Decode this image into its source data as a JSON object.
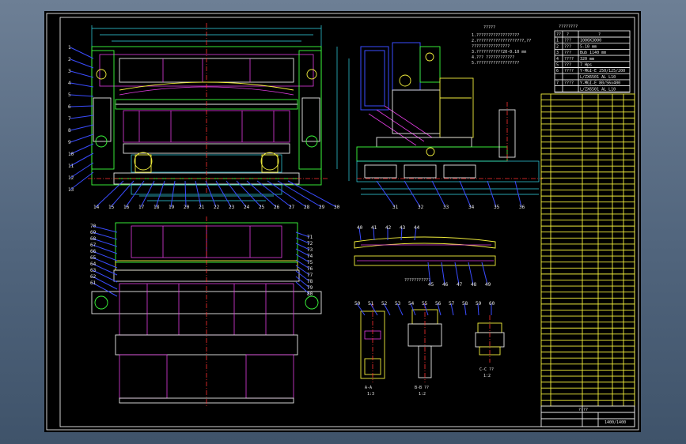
{
  "colors": {
    "backdrop": "#5a6e86",
    "paper": "#000000",
    "outline": "#e8e8e8",
    "green": "#3cff3c",
    "magenta": "#e23ce2",
    "cyan": "#34d8e8",
    "blue": "#3a4cff",
    "yellow": "#f2ee3c",
    "red": "#ff3030"
  },
  "tech_notes": {
    "heading": "?????",
    "lines": [
      "1.??????????????????",
      "2.????????????????????,??",
      "  ????????????????",
      "3.???????????20-0.10 mm",
      "4.??? ????????????",
      "5.??????????????????"
    ]
  },
  "spec_table": {
    "heading": "????????",
    "columns": [
      "??",
      "?",
      "?"
    ],
    "rows": [
      {
        "no": "1",
        "name": "???",
        "value": "1000X3000"
      },
      {
        "no": "2",
        "name": "???",
        "value": "5-10   mm"
      },
      {
        "no": "3",
        "name": "???",
        "value": "Bub   1140 mm"
      },
      {
        "no": "4",
        "name": "????",
        "value": "320 mm"
      },
      {
        "no": "5",
        "name": "???",
        "value": "7 Hps"
      },
      {
        "no": "6",
        "name": "????",
        "value": "Y-MGI-E 250/125/200"
      },
      {
        "no": "6b",
        "name": "",
        "value": "L/ZX6501 AL L10"
      },
      {
        "no": "7",
        "name": "????",
        "value": "Y-MGI-E 80/56x400"
      },
      {
        "no": "7b",
        "name": "",
        "value": "L/ZX6501 AL L10"
      }
    ]
  },
  "section_labels": {
    "a_a": "A-A",
    "a_a_scale": "1:3",
    "b_b": "B-B ??",
    "b_b_scale": "1:2",
    "c_c": "C-C ??",
    "c_c_scale": "1:2",
    "detail_note": "???????????"
  },
  "front_view_callouts_bottom": [
    "14",
    "15",
    "16",
    "17",
    "18",
    "19",
    "20",
    "21",
    "22",
    "23",
    "24",
    "25",
    "26",
    "27",
    "28",
    "29",
    "30"
  ],
  "side_view_callouts_bottom": [
    "31",
    "32",
    "33",
    "34",
    "35",
    "36"
  ],
  "front_view_callouts_left": [
    "1",
    "2",
    "3",
    "4",
    "5",
    "6",
    "7",
    "8",
    "9",
    "10",
    "11",
    "12",
    "13"
  ],
  "plan_view_callouts_left": [
    "70",
    "69",
    "68",
    "67",
    "66",
    "65",
    "64",
    "63",
    "62",
    "61"
  ],
  "plan_view_callouts_right": [
    "71",
    "72",
    "73",
    "74",
    "75",
    "76",
    "77",
    "78",
    "79",
    "80"
  ],
  "segment_callouts": [
    "40",
    "41",
    "42",
    "43",
    "44",
    "45",
    "46",
    "47",
    "48",
    "49"
  ],
  "detail_callouts": [
    "50",
    "51",
    "52",
    "53",
    "54",
    "55",
    "56",
    "57",
    "58",
    "59",
    "60"
  ],
  "bom": {
    "row_count": 52,
    "footer_title": "????",
    "drawing_no": "1400/1400"
  }
}
